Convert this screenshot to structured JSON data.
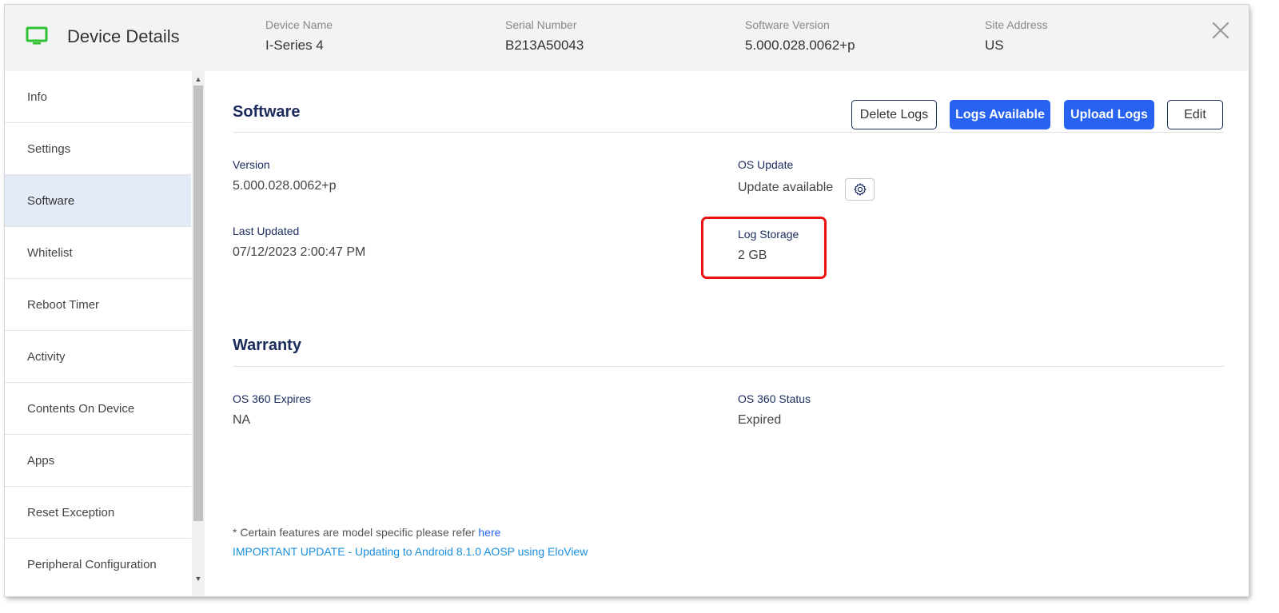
{
  "header": {
    "title": "Device Details",
    "fields": [
      {
        "label": "Device Name",
        "value": "I-Series 4"
      },
      {
        "label": "Serial Number",
        "value": "B213A50043"
      },
      {
        "label": "Software Version",
        "value": "5.000.028.0062+p"
      },
      {
        "label": "Site Address",
        "value": "US"
      }
    ],
    "close_icon": "close-icon",
    "device_icon": "monitor-icon",
    "device_icon_color": "#2fc12f"
  },
  "sidebar": {
    "items": [
      {
        "label": "Info",
        "active": false
      },
      {
        "label": "Settings",
        "active": false
      },
      {
        "label": "Software",
        "active": true
      },
      {
        "label": "Whitelist",
        "active": false
      },
      {
        "label": "Reboot Timer",
        "active": false
      },
      {
        "label": "Activity",
        "active": false
      },
      {
        "label": "Contents On Device",
        "active": false
      },
      {
        "label": "Apps",
        "active": false
      },
      {
        "label": "Reset Exception",
        "active": false
      },
      {
        "label": "Peripheral Configuration",
        "active": false
      }
    ]
  },
  "software": {
    "title": "Software",
    "buttons": {
      "delete_logs": "Delete Logs",
      "logs_available": "Logs Available",
      "upload_logs": "Upload Logs",
      "edit": "Edit"
    },
    "version": {
      "label": "Version",
      "value": "5.000.028.0062+p"
    },
    "os_update": {
      "label": "OS Update",
      "value": "Update available"
    },
    "last_updated": {
      "label": "Last Updated",
      "value": "07/12/2023 2:00:47 PM"
    },
    "log_storage": {
      "label": "Log Storage",
      "value": "2 GB"
    }
  },
  "warranty": {
    "title": "Warranty",
    "expires": {
      "label": "OS 360 Expires",
      "value": "NA"
    },
    "status": {
      "label": "OS 360 Status",
      "value": "Expired"
    }
  },
  "footer": {
    "note": "* Certain features are model specific please refer ",
    "note_link": "here",
    "important_link": "IMPORTANT UPDATE - Updating to Android 8.1.0 AOSP using EloView"
  },
  "colors": {
    "primary_button": "#2763f0",
    "heading": "#1a2b5c",
    "highlight_box": "#ee1111",
    "active_sidebar": "#e4ebf8"
  }
}
